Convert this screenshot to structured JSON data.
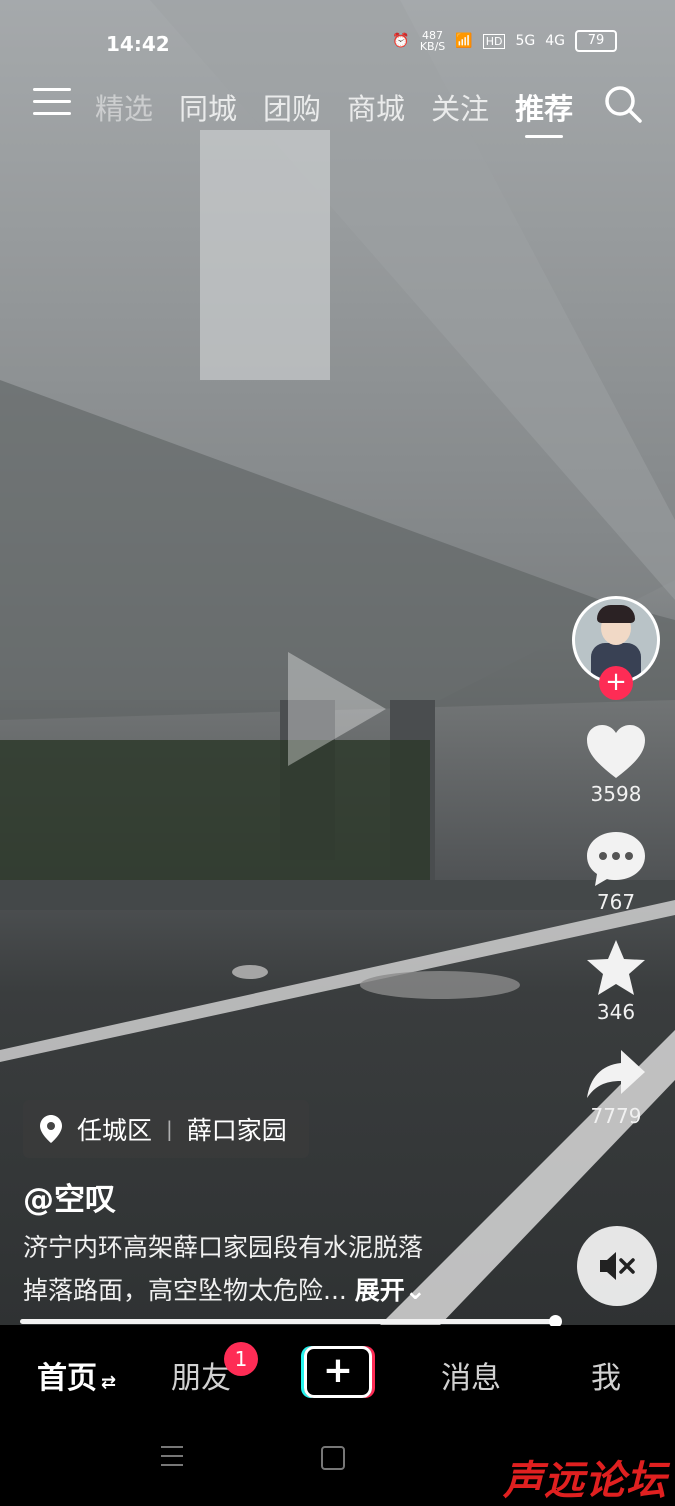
{
  "status": {
    "time": "14:42",
    "net_speed": "487\nKB/S",
    "signal_5g": "5G",
    "signal_4g": "4G",
    "hd": "HD",
    "battery": "79"
  },
  "topnav": {
    "tabs": [
      "精选",
      "同城",
      "团购",
      "商城",
      "关注",
      "推荐"
    ],
    "active_tab": "推荐"
  },
  "video": {
    "likes": "3598",
    "comments": "767",
    "favorites": "346",
    "shares": "7779",
    "location_district": "任城区",
    "location_place": "薛口家园",
    "author": "@空叹",
    "description_line1": "济宁内环高架薛口家园段有水泥脱落",
    "description_line2": "掉落路面，高空坠物太危险...",
    "expand_label": "展开",
    "progress_fraction": 0.8
  },
  "bottomnav": {
    "home": "首页",
    "friends": "朋友",
    "friends_badge": "1",
    "create": "+",
    "messages": "消息",
    "me": "我"
  },
  "watermark": "声远论坛",
  "colors": {
    "accent": "#fe2c55",
    "background": "#000000"
  }
}
